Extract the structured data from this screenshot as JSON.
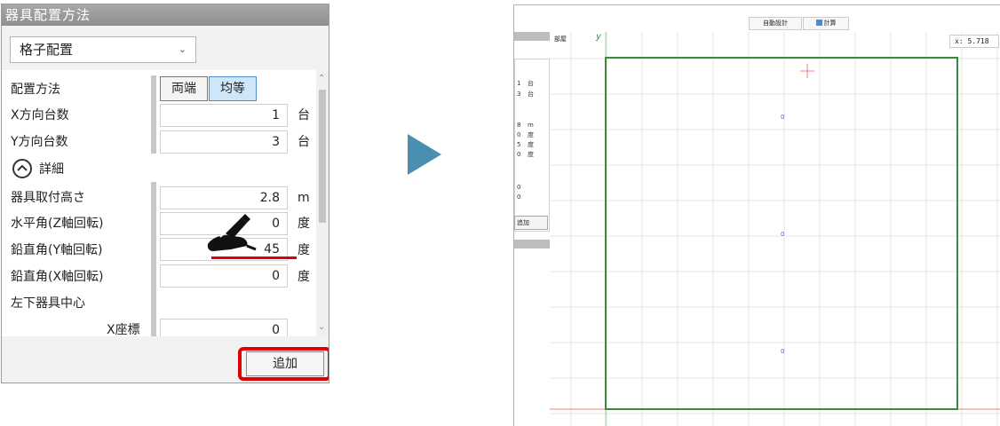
{
  "panel": {
    "title": "器具配置方法",
    "method_select": "格子配置",
    "placement_label": "配置方法",
    "btn_ryotan": "両端",
    "btn_kinto": "均等",
    "x_count_label": "X方向台数",
    "x_count_value": "1",
    "x_count_unit": "台",
    "y_count_label": "Y方向台数",
    "y_count_value": "3",
    "y_count_unit": "台",
    "detail_label": "詳細",
    "height_label": "器具取付高さ",
    "height_value": "2.8",
    "height_unit": "m",
    "horiz_label": "水平角(Z軸回転)",
    "horiz_value": "0",
    "horiz_unit": "度",
    "vert_y_label": "鉛直角(Y軸回転)",
    "vert_y_value": "45",
    "vert_y_unit": "度",
    "vert_x_label": "鉛直角(X軸回転)",
    "vert_x_value": "0",
    "vert_x_unit": "度",
    "lower_left_label": "左下器具中心",
    "x_coord_label": "X座標",
    "x_coord_value": "0",
    "add_button": "追加"
  },
  "canvas": {
    "toolbar_auto": "自動設計",
    "toolbar_calc": "計算",
    "coord_readout": "x:  5.718",
    "room_label": "部屋",
    "y_axis_label": "y",
    "inner_rows": [
      {
        "value": "1",
        "unit": "台"
      },
      {
        "value": "3",
        "unit": "台"
      },
      {
        "value": "8",
        "unit": "m"
      },
      {
        "value": "0",
        "unit": "度"
      },
      {
        "value": "5",
        "unit": "度"
      },
      {
        "value": "0",
        "unit": "度"
      }
    ],
    "inner_extra": [
      "0",
      "0"
    ],
    "inner_add": "追加",
    "fixture_markers": [
      "0",
      "0",
      "0"
    ]
  },
  "colors": {
    "room_outline": "#3a8a3a",
    "highlight": "#e00000",
    "arrow": "#4a8fb0",
    "selected_button": "#cfe6f8"
  }
}
